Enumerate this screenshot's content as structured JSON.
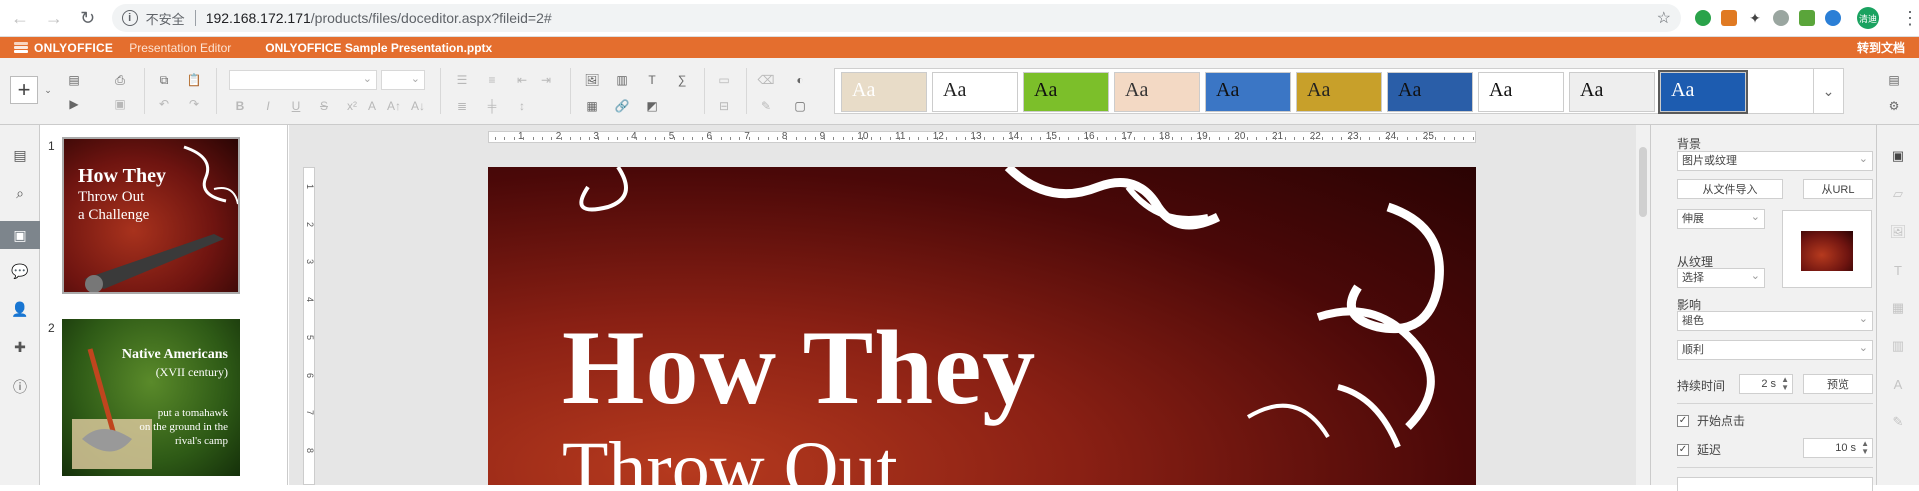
{
  "browser": {
    "security_label": "不安全",
    "url_host": "192.168.172.171",
    "url_path": "/products/files/doceditor.aspx?fileid=2#",
    "profile_label": "清迪"
  },
  "header": {
    "logo_text": "ONLYOFFICE",
    "app_name": "Presentation Editor",
    "document_title": "ONLYOFFICE Sample Presentation.pptx",
    "go_to_docs": "转到文档"
  },
  "themes": [
    {
      "label": "Aa",
      "bg": "#e8dcc8",
      "fg": "#ffffff"
    },
    {
      "label": "Aa",
      "bg": "#ffffff",
      "fg": "#222222"
    },
    {
      "label": "Aa",
      "bg": "#7cbf2a",
      "fg": "#111111"
    },
    {
      "label": "Aa",
      "bg": "#f3d9c4",
      "fg": "#333333"
    },
    {
      "label": "Aa",
      "bg": "#3b76c5",
      "fg": "#111111"
    },
    {
      "label": "Aa",
      "bg": "#c8a02a",
      "fg": "#222222"
    },
    {
      "label": "Aa",
      "bg": "#2a5ea8",
      "fg": "#111111"
    },
    {
      "label": "Aa",
      "bg": "#ffffff",
      "fg": "#111111"
    },
    {
      "label": "Aa",
      "bg": "#eeeeee",
      "fg": "#111111"
    },
    {
      "label": "Aa",
      "bg": "#1d5cb0",
      "fg": "#ffffff"
    }
  ],
  "slides": [
    {
      "number": "1",
      "title_line1": "How They",
      "title_line2": "Throw Out",
      "title_line3": "a Challenge"
    },
    {
      "number": "2",
      "title": "Native Americans",
      "subtitle": "(XVII century)",
      "body_line1": "put a tomahawk",
      "body_line2": "on the ground in the",
      "body_line3": "rival's camp"
    }
  ],
  "ruler": {
    "h_labels": [
      "1",
      "2",
      "3",
      "4",
      "5",
      "6",
      "7",
      "8",
      "9",
      "10",
      "11",
      "12",
      "13",
      "14",
      "15",
      "16",
      "17",
      "18",
      "19",
      "20",
      "21",
      "22",
      "23",
      "24",
      "25"
    ],
    "v_labels": [
      "1",
      "2",
      "3",
      "4",
      "5",
      "6",
      "7",
      "8"
    ]
  },
  "slide_canvas": {
    "title": "How They",
    "subtitle": "Throw Out"
  },
  "settings": {
    "background_label": "背景",
    "fill_type": "图片或纹理",
    "from_file": "从文件导入",
    "from_url": "从URL",
    "stretch": "伸展",
    "from_texture_label": "从纹理",
    "texture_select": "选择",
    "effect_label": "影响",
    "effect_value": "褪色",
    "direction_value": "顺利",
    "duration_label": "持续时间",
    "duration_value": "2 s",
    "preview_btn": "预览",
    "start_on_click": "开始点击",
    "delay_label": "延迟",
    "delay_value": "10 s"
  }
}
